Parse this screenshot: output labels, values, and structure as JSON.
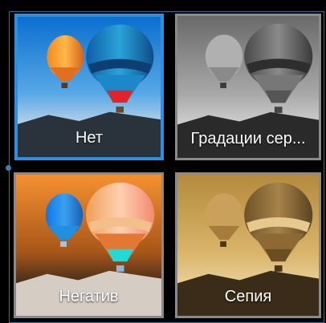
{
  "effects": [
    {
      "id": "none",
      "label": "Нет",
      "selected": true
    },
    {
      "id": "grayscale",
      "label": "Градации сер..."
    },
    {
      "id": "negative",
      "label": "Негатив"
    },
    {
      "id": "sepia",
      "label": "Сепия"
    }
  ],
  "colors": {
    "selection": "#2e8fe0",
    "tile_border": "#8a8a8a"
  }
}
